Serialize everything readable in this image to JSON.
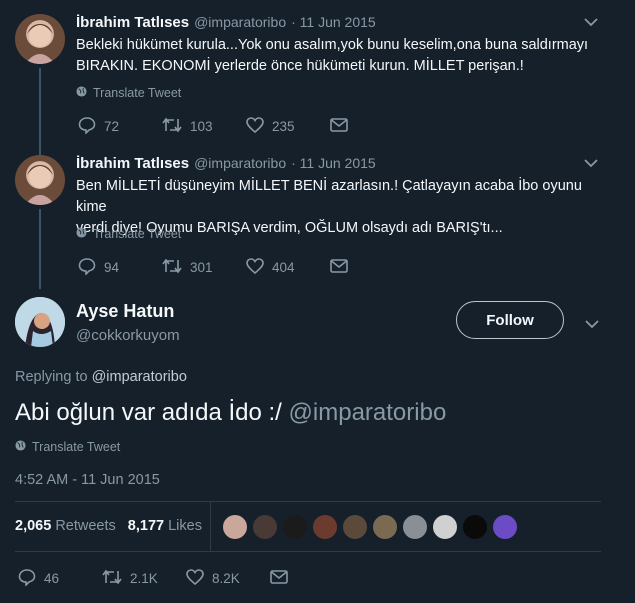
{
  "thread": [
    {
      "display_name": "İbrahim Tatlıses",
      "handle": "@imparatoribo",
      "date": "· 11 Jun 2015",
      "text_line1": "Bekleki hükümet kurula...Yok onu asalım,yok bunu keselim,ona buna saldırmayı",
      "text_line2": "BIRAKIN. EKONOMİ yerlerde önce hükümeti kurun. MİLLET perişan.!",
      "translate": "Translate Tweet",
      "replies": "72",
      "retweets": "103",
      "likes": "235"
    },
    {
      "display_name": "İbrahim Tatlıses",
      "handle": "@imparatoribo",
      "date": "· 11 Jun 2015",
      "text_line1": "Ben MİLLETİ düşüneyim MİLLET BENİ azarlasın.! Çatlayayın acaba İbo oyunu kime",
      "text_line2": "verdi diye! Oyumu BARIŞA verdim, OĞLUM olsaydı adı BARIŞ'tı...",
      "translate": "Translate Tweet",
      "replies": "94",
      "retweets": "301",
      "likes": "404"
    }
  ],
  "main": {
    "display_name": "Ayse Hatun",
    "handle": "@cokkorkuyom",
    "follow_label": "Follow",
    "replying_prefix": "Replying to",
    "replying_handle": "@imparatoribo",
    "text": "Abi oğlun var adıda İdo :/",
    "text_mention": "@imparatoribo",
    "translate": "Translate Tweet",
    "timestamp": "4:52 AM - 11 Jun 2015",
    "retweet_count": "2,065",
    "retweet_label": "Retweets",
    "like_count": "8,177",
    "like_label": "Likes",
    "replies": "46",
    "retweets": "2.1K",
    "likes": "8.2K"
  },
  "colors": {
    "background": "#16202b",
    "link": "#8899a6",
    "mention_main": "#8899a6"
  },
  "icons": [
    "reply-icon",
    "retweet-icon",
    "like-icon",
    "mail-icon",
    "globe-icon",
    "chevron-down-icon"
  ]
}
